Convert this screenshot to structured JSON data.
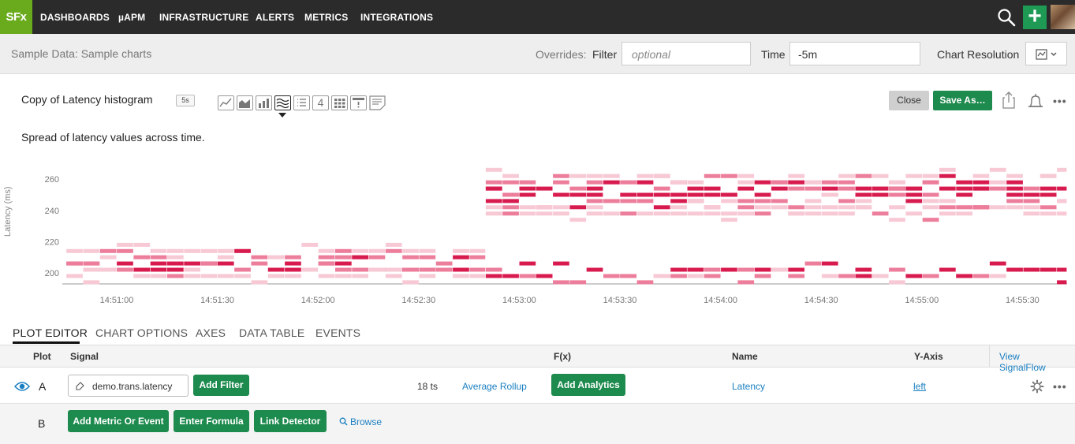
{
  "nav": {
    "logo": "SFx",
    "items": [
      {
        "label": "DASHBOARDS"
      },
      {
        "label": "µAPM"
      },
      {
        "label": "INFRASTRUCTURE"
      },
      {
        "label": "ALERTS"
      },
      {
        "label": "METRICS"
      },
      {
        "label": "INTEGRATIONS"
      }
    ],
    "plus_label": "+"
  },
  "subheader": {
    "breadcrumb": "Sample Data: Sample charts",
    "overrides_label": "Overrides:",
    "filter_label": "Filter",
    "filter_placeholder": "optional",
    "time_label": "Time",
    "time_value": "-5m",
    "resolution_label": "Chart Resolution"
  },
  "chart_header": {
    "title": "Copy of Latency histogram",
    "resolution_badge": "5s",
    "chart_types": [
      "line-chart-icon",
      "area-chart-icon",
      "column-chart-icon",
      "heatmap-chart-icon",
      "list-chart-icon",
      "single-value-icon",
      "grid-heatmap-icon",
      "event-feed-icon",
      "text-note-icon"
    ],
    "single_value_label": "4",
    "active_type": "heatmap-chart-icon",
    "close_label": "Close",
    "save_as_label": "Save As…",
    "description": "Spread of latency values across time."
  },
  "chart_data": {
    "type": "heatmap",
    "ylabel": "Latency (ms)",
    "y_ticks": [
      200,
      220,
      240,
      260
    ],
    "x_ticks": [
      "14:51:00",
      "14:51:30",
      "14:52:00",
      "14:52:30",
      "14:53:00",
      "14:53:30",
      "14:54:00",
      "14:54:30",
      "14:55:00",
      "14:55:30"
    ],
    "colors": {
      "high": "#d81b4f",
      "mid": "#ec7d9b",
      "low": "#f7c9d5"
    },
    "phases": [
      {
        "from": "14:50:45",
        "to": "14:52:50",
        "bands": [
          {
            "latency": 214,
            "intensity": "low"
          },
          {
            "latency": 210,
            "intensity": "mid"
          },
          {
            "latency": 206,
            "intensity": "high"
          },
          {
            "latency": 202,
            "intensity": "mid"
          },
          {
            "latency": 198,
            "intensity": "low"
          }
        ]
      },
      {
        "from": "14:52:50",
        "to": "14:55:50",
        "bands": [
          {
            "latency": 262,
            "intensity": "low"
          },
          {
            "latency": 258,
            "intensity": "mid"
          },
          {
            "latency": 254,
            "intensity": "high"
          },
          {
            "latency": 250,
            "intensity": "high"
          },
          {
            "latency": 246,
            "intensity": "mid"
          },
          {
            "latency": 242,
            "intensity": "low"
          },
          {
            "latency": 238,
            "intensity": "low"
          },
          {
            "latency": 202,
            "intensity": "high"
          },
          {
            "latency": 198,
            "intensity": "mid"
          }
        ]
      }
    ]
  },
  "tabs": [
    {
      "label": "PLOT EDITOR"
    },
    {
      "label": "CHART OPTIONS"
    },
    {
      "label": "AXES"
    },
    {
      "label": "DATA TABLE"
    },
    {
      "label": "EVENTS"
    }
  ],
  "plot_editor": {
    "columns": {
      "plot": "Plot",
      "signal": "Signal",
      "fx": "F(x)",
      "name": "Name",
      "yaxis": "Y-Axis"
    },
    "view_signalflow": "View SignalFlow",
    "row_a": {
      "label": "A",
      "signal": "demo.trans.latency",
      "add_filter": "Add Filter",
      "ts_count": "18 ts",
      "rollup": "Average Rollup",
      "add_analytics": "Add Analytics",
      "name": "Latency",
      "yaxis": "left"
    },
    "row_b": {
      "label": "B",
      "add_metric": "Add Metric Or Event",
      "enter_formula": "Enter Formula",
      "link_detector": "Link Detector",
      "browse": "Browse"
    }
  }
}
